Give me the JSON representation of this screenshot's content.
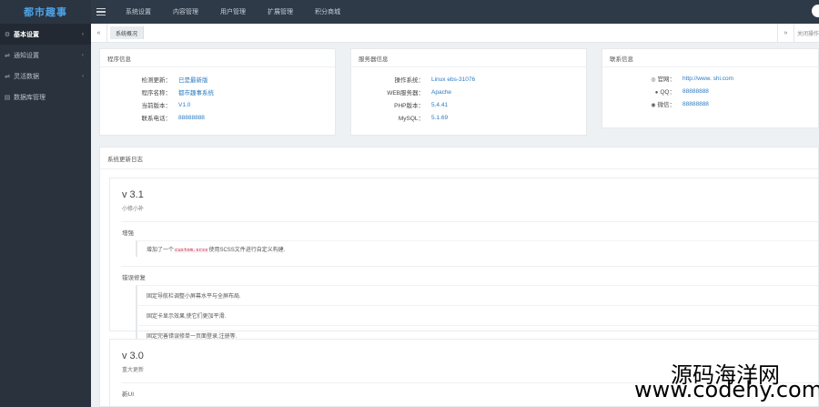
{
  "header": {
    "logo": "都市趣事",
    "nav": [
      "系统设置",
      "内容管理",
      "用户管理",
      "扩展管理",
      "积分商城"
    ]
  },
  "sidebar": {
    "items": [
      {
        "label": "基本设置",
        "icon": "gears-icon",
        "active": true
      },
      {
        "label": "通知设置",
        "icon": "share-icon",
        "active": false
      },
      {
        "label": "灵活数据",
        "icon": "share-icon",
        "active": false
      },
      {
        "label": "数据库管理",
        "icon": "database-icon",
        "active": false
      }
    ]
  },
  "tabs": {
    "back_symbol": "«",
    "active_tab": "系统概况",
    "forward_symbol": "»",
    "close_label": "关闭操作"
  },
  "program_info": {
    "title": "程序信息",
    "rows": [
      {
        "key": "检测更新：",
        "value": "已是最新版"
      },
      {
        "key": "程序名称：",
        "value": "都市趣事系统"
      },
      {
        "key": "当前版本：",
        "value": "V1.0"
      },
      {
        "key": "联系电话：",
        "value": "88888888"
      }
    ]
  },
  "server_info": {
    "title": "服务器信息",
    "rows": [
      {
        "key": "操作系统：",
        "value": "Linux ebs-31076"
      },
      {
        "key": "WEB服务器：",
        "value": "Apache"
      },
      {
        "key": "PHP版本：",
        "value": "5.4.41"
      },
      {
        "key": "MySQL：",
        "value": "5.1.69"
      }
    ]
  },
  "contact_info": {
    "title": "联系信息",
    "rows": [
      {
        "key": "官网：",
        "value": "http://www.          shi.com",
        "icon": "globe-icon"
      },
      {
        "key": "QQ：",
        "value": "88888888",
        "icon": "qq-icon"
      },
      {
        "key": "微信：",
        "value": "88888888",
        "icon": "wechat-icon"
      }
    ]
  },
  "changelog": {
    "title": "系统更新日志",
    "versions": [
      {
        "version": "v 3.1",
        "subtitle": "小修小补",
        "sections": [
          {
            "heading": "增强",
            "lines": [
              {
                "before": "增加了一个",
                "code": "custom.scss",
                "after": "使用SCSS文件进行自定义构建."
              }
            ]
          },
          {
            "heading": "错误修复",
            "lines": [
              {
                "before": "固定导航栏调整小屏幕水平与全屏布局.",
                "code": "",
                "after": ""
              },
              {
                "before": "固定卡显示效果,使它们更加平滑.",
                "code": "",
                "after": ""
              },
              {
                "before": "固定完善错误修单一页面登录,注册等.",
                "code": "",
                "after": ""
              }
            ]
          }
        ]
      },
      {
        "version": "v 3.0",
        "subtitle": "重大更新",
        "sections": [
          {
            "heading": "新UI",
            "lines": []
          }
        ]
      }
    ]
  },
  "watermark": {
    "line1": "源码海洋网",
    "line2": "www.codehy.com"
  }
}
